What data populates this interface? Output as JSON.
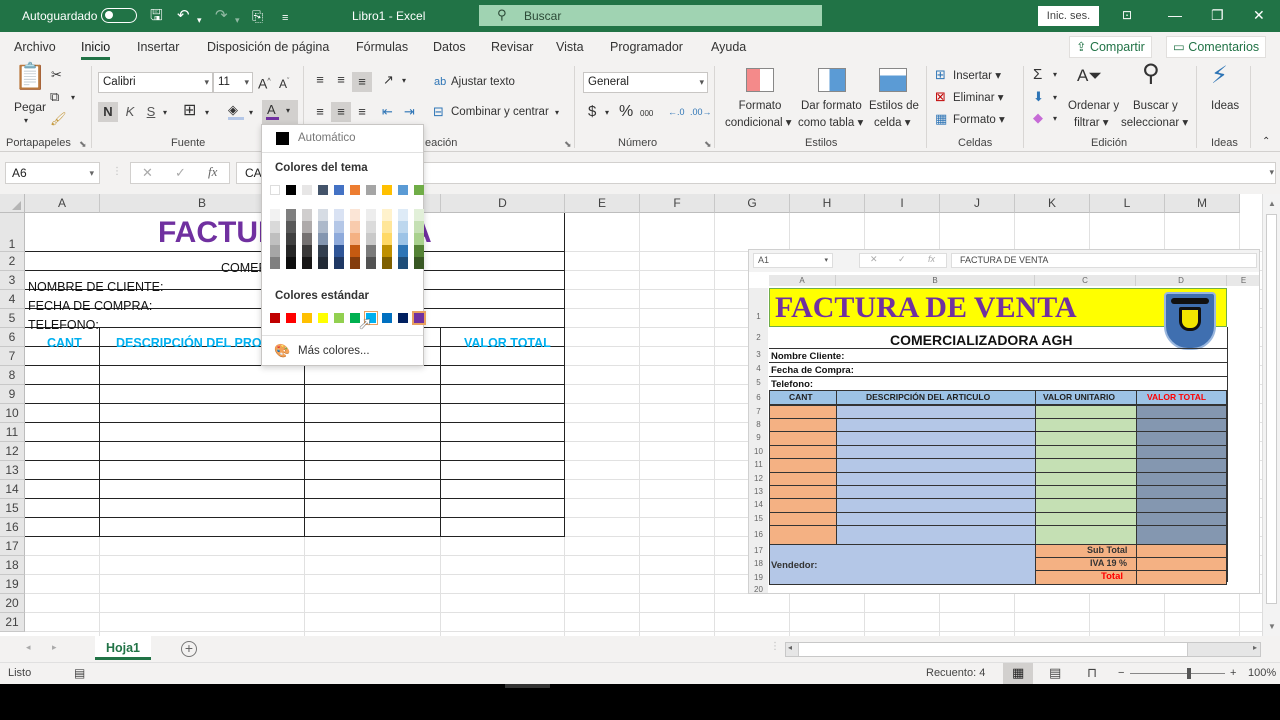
{
  "titlebar": {
    "autosave_label": "Autoguardado",
    "doc_title": "Libro1  -  Excel",
    "search_placeholder": "Buscar",
    "signin_label": "Inic. ses."
  },
  "tabs": [
    {
      "label": "Archivo"
    },
    {
      "label": "Inicio",
      "active": true
    },
    {
      "label": "Insertar"
    },
    {
      "label": "Disposición de página"
    },
    {
      "label": "Fórmulas"
    },
    {
      "label": "Datos"
    },
    {
      "label": "Revisar"
    },
    {
      "label": "Vista"
    },
    {
      "label": "Programador"
    },
    {
      "label": "Ayuda"
    }
  ],
  "share_label": "Compartir",
  "comments_label": "Comentarios",
  "ribbon": {
    "clipboard": {
      "paste": "Pegar",
      "group": "Portapapeles"
    },
    "font": {
      "name": "Calibri",
      "size": "11",
      "bold": "N",
      "italic": "K",
      "underline": "S",
      "group": "Fuente"
    },
    "alignment": {
      "wrap": "Ajustar texto",
      "merge": "Combinar y centrar",
      "group": "Alineación",
      "group_visible": "eación"
    },
    "number": {
      "format": "General",
      "currency": "$",
      "percent": "%",
      "thousands": "000",
      "group": "Número"
    },
    "styles": {
      "conditional": "Formato condicional",
      "conditional_1": "Formato",
      "conditional_2": "condicional",
      "as_table_1": "Dar formato",
      "as_table_2": "como tabla",
      "cell_styles_1": "Estilos de",
      "cell_styles_2": "celda",
      "group": "Estilos"
    },
    "cells": {
      "insert": "Insertar",
      "delete": "Eliminar",
      "format": "Formato",
      "group": "Celdas"
    },
    "editing": {
      "sort_1": "Ordenar y",
      "sort_2": "filtrar",
      "find_1": "Buscar y",
      "find_2": "seleccionar",
      "group": "Edición"
    },
    "ideas": {
      "label": "Ideas",
      "group": "Ideas"
    }
  },
  "formula_bar": {
    "name_box": "A6",
    "formula": "CA"
  },
  "grid": {
    "columns": [
      "A",
      "B",
      "C",
      "D",
      "E",
      "F",
      "G",
      "H",
      "I",
      "J",
      "K",
      "L",
      "M"
    ],
    "rows": [
      "1",
      "2",
      "3",
      "4",
      "5",
      "6",
      "7",
      "8",
      "9",
      "10",
      "11",
      "12",
      "13",
      "14",
      "15",
      "16",
      "17",
      "18",
      "19",
      "20",
      "21"
    ],
    "cells": {
      "title": "FACTURA DE VENTA",
      "title_visible_left": "FACTUR",
      "title_visible_right": "A",
      "company_visible": "COMEF",
      "client": "NOMBRE DE CLIENTE:",
      "date": "FECHA DE COMPRA:",
      "phone": "TELEFONO:",
      "h_qty": "CANT",
      "h_desc": "DESCRIPCIÓN DEL PRODU",
      "h_total": "VALOR TOTAL"
    },
    "title_color": "#7030a0",
    "header_color": "#00b0f0"
  },
  "embedded_reference": {
    "name_box": "A1",
    "formula": "FACTURA DE VENTA",
    "columns": [
      "A",
      "B",
      "C",
      "D",
      "E"
    ],
    "rows": [
      "1",
      "2",
      "3",
      "4",
      "5",
      "6",
      "7",
      "8",
      "9",
      "10",
      "11",
      "12",
      "13",
      "14",
      "15",
      "16",
      "17",
      "18",
      "19",
      "20"
    ],
    "title": "FACTURA DE VENTA",
    "company": "COMERCIALIZADORA AGH",
    "client": "Nombre Cliente:",
    "date": "Fecha de Compra:",
    "phone": "Telefono:",
    "h_qty": "CANT",
    "h_desc": "DESCRIPCIÓN DEL ARTICULO",
    "h_unit": "VALOR UNITARIO",
    "h_total": "VALOR TOTAL",
    "seller": "Vendedor:",
    "subtotal": "Sub Total",
    "iva": "IVA 19 %",
    "total": "Total",
    "logo": "colegio-crest",
    "colors": {
      "title_bg": "#ffff00",
      "title_fg": "#7030a0",
      "qty": "#f4b183",
      "desc": "#b4c7e7",
      "unit": "#c5e0b4",
      "total_col": "#8497b0",
      "header_bg": "#9dc3e6",
      "total_red": "#ff0000"
    }
  },
  "color_picker": {
    "automatic": "Automático",
    "theme_title": "Colores del tema",
    "standard_title": "Colores estándar",
    "more_colors": "Más colores...",
    "theme_top": [
      "#ffffff",
      "#000000",
      "#e7e6e6",
      "#44546a",
      "#4472c4",
      "#ed7d31",
      "#a5a5a5",
      "#ffc000",
      "#5b9bd5",
      "#70ad47"
    ],
    "theme_shades": [
      [
        "#f2f2f2",
        "#d9d9d9",
        "#bfbfbf",
        "#a6a6a6",
        "#808080"
      ],
      [
        "#7f7f7f",
        "#595959",
        "#404040",
        "#262626",
        "#0d0d0d"
      ],
      [
        "#d0cece",
        "#aeaaaa",
        "#757171",
        "#3a3838",
        "#171616"
      ],
      [
        "#d6dce4",
        "#adb9ca",
        "#8496b0",
        "#333f4f",
        "#222a35"
      ],
      [
        "#d9e2f3",
        "#b4c7e7",
        "#8eaadb",
        "#2f5597",
        "#1f3864"
      ],
      [
        "#fbe5d6",
        "#f8cbad",
        "#f4b183",
        "#c55a11",
        "#843c0c"
      ],
      [
        "#ededed",
        "#dbdbdb",
        "#c9c9c9",
        "#7b7b7b",
        "#525252"
      ],
      [
        "#fff2cc",
        "#ffe699",
        "#ffd966",
        "#bf9000",
        "#7f6000"
      ],
      [
        "#deebf7",
        "#bdd7ee",
        "#9dc3e6",
        "#2e75b6",
        "#1f4e79"
      ],
      [
        "#e2f0d9",
        "#c5e0b4",
        "#a9d18e",
        "#548235",
        "#385723"
      ]
    ],
    "standard": [
      "#c00000",
      "#ff0000",
      "#ffc000",
      "#ffff00",
      "#92d050",
      "#00b050",
      "#00b0f0",
      "#0070c0",
      "#002060",
      "#7030a0"
    ],
    "hovered_index": 6,
    "selected_index": 9
  },
  "sheet_tabs": [
    {
      "label": "Hoja1",
      "active": true
    }
  ],
  "status": {
    "ready": "Listo",
    "count": "Recuento: 4",
    "zoom": "100%",
    "zoom_value": 100
  }
}
